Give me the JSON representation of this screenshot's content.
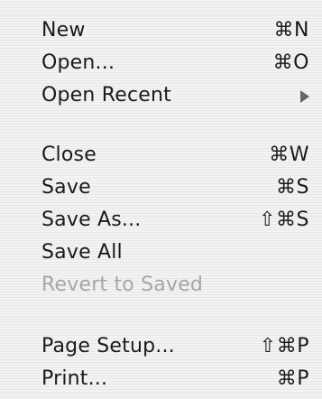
{
  "menu": {
    "items": [
      {
        "label": "New",
        "shortcut": "⌘N"
      },
      {
        "label": "Open...",
        "shortcut": "⌘O"
      },
      {
        "label": "Open Recent",
        "shortcut": ""
      },
      {
        "label": "Close",
        "shortcut": "⌘W"
      },
      {
        "label": "Save",
        "shortcut": "⌘S"
      },
      {
        "label": "Save As...",
        "shortcut": "⇧⌘S"
      },
      {
        "label": "Save All",
        "shortcut": ""
      },
      {
        "label": "Revert to Saved",
        "shortcut": ""
      },
      {
        "label": "Page Setup...",
        "shortcut": "⇧⌘P"
      },
      {
        "label": "Print...",
        "shortcut": "⌘P"
      }
    ],
    "submenu_icon": "submenu-arrow-icon",
    "disabled_text_color": "#a6a6a6"
  }
}
